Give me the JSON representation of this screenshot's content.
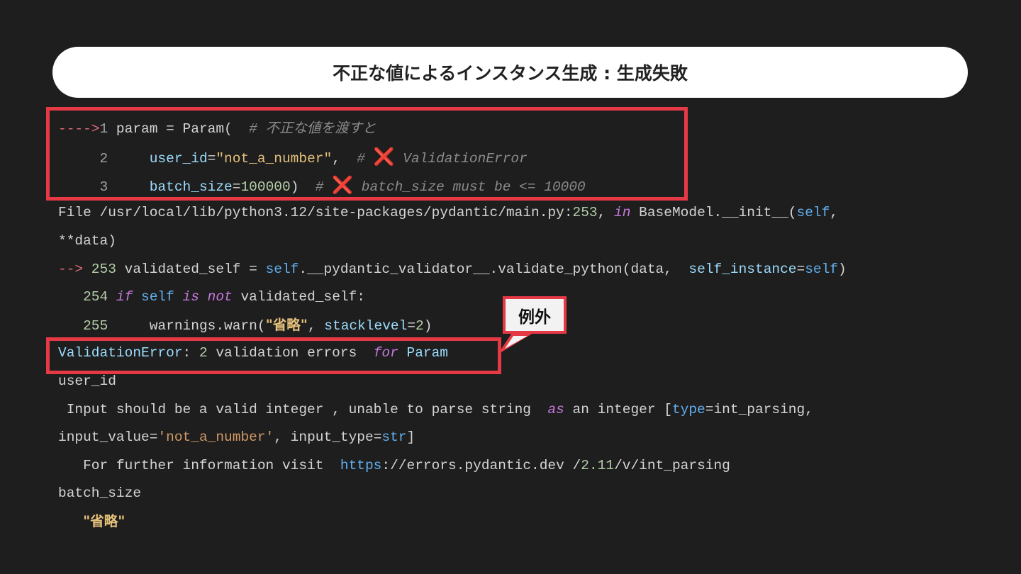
{
  "title": "不正な値によるインスタンス生成 : 生成失敗",
  "callout_label": "例外",
  "code": {
    "l1": {
      "arrow": "---->",
      "num": "1",
      "text": " param = Param(  ",
      "comment": "# 不正な値を渡すと"
    },
    "l2": {
      "num": "2",
      "kw": "user_id",
      "eq": "=",
      "str": "\"not_a_number\"",
      "rest": ",  ",
      "hash": "# ",
      "x": "❌",
      "comment": " ValidationError"
    },
    "l3": {
      "num": "3",
      "kw": "batch_size",
      "eq": "=",
      "val": "100000",
      "rest": ")  ",
      "hash": "# ",
      "x": "❌",
      "comment": " batch_size must be <= 10000"
    },
    "l4": {
      "a": "File ",
      "path": "/usr/local/lib/python3.12/site-packages/pydantic/main.py:",
      "lineno": "253",
      "b": ", ",
      "in": "in",
      "c": " BaseModel.__init__(",
      "self": "self",
      "d": ","
    },
    "l5": "**data)",
    "l6": {
      "arrow": "-->",
      "num": " 253",
      "a": " validated_self = ",
      "self": "self",
      "b": ".__pydantic_validator__.validate_python(data,  ",
      "kw": "self_instance",
      "eq": "=",
      "self2": "self",
      "c": ")"
    },
    "l7": {
      "num": "254",
      "if": "if",
      "self": "self",
      "is": "is",
      "not": "not",
      "rest": " validated_self:"
    },
    "l8": {
      "num": "255",
      "a": "     warnings.warn(",
      "str": "\"省略\"",
      "b": ", ",
      "kw": "stacklevel",
      "eq": "=",
      "n": "2",
      "c": ")"
    },
    "l9": {
      "err": "ValidationError",
      "a": ": ",
      "n": "2",
      "b": " validation errors  ",
      "for": "for",
      "c": " Param"
    },
    "l10": "user_id",
    "l11": {
      "a": " Input should be a valid integer , unable to parse string  ",
      "as": "as",
      "b": " an integer [",
      "type": "type",
      "c": "=int_parsing,"
    },
    "l12": {
      "a": "input_value=",
      "str": "'not_a_number'",
      "b": ", input_type=",
      "t": "str",
      "c": "]"
    },
    "l13": {
      "a": "   For further information visit  ",
      "https": "https",
      "b": "://errors.pydantic.dev /",
      "v": "2.11",
      "c": "/v/int_parsing"
    },
    "l14": "batch_size",
    "l15": "\"省略\""
  }
}
